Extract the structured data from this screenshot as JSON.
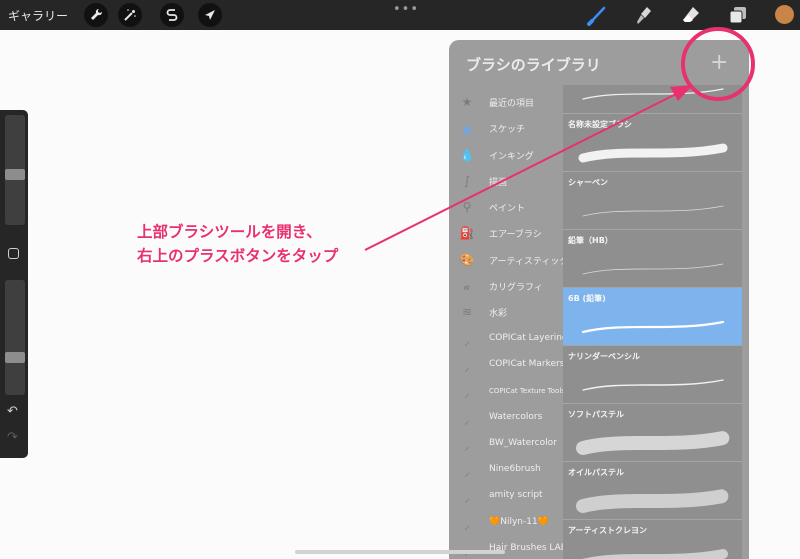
{
  "topbar": {
    "gallery_label": "ギャラリー",
    "actions_icon": "wrench-icon",
    "adjustments_icon": "magic-wand-icon",
    "selection_icon": "selection-s-icon",
    "transform_icon": "arrow-cursor-icon",
    "more_label": "•••",
    "tools": [
      "brush-icon",
      "smudge-icon",
      "eraser-icon",
      "layers-icon"
    ],
    "active_tool": "brush-icon",
    "color_swatch": "#c98448"
  },
  "sidebar": {
    "size_level": 0.55,
    "opacity_level": 0.8,
    "undo_label": "↶",
    "redo_label": "↷"
  },
  "panel": {
    "title": "ブラシのライブラリ",
    "add_label": "+",
    "categories": [
      {
        "label": "最近の項目",
        "icon": "star-icon"
      },
      {
        "label": "スケッチ",
        "icon": "pencil-tip-icon"
      },
      {
        "label": "インキング",
        "icon": "ink-drop-icon"
      },
      {
        "label": "描画",
        "icon": "swirl-icon"
      },
      {
        "label": "ペイント",
        "icon": "paintbrush-icon"
      },
      {
        "label": "エアーブラシ",
        "icon": "airbrush-icon"
      },
      {
        "label": "アーティスティック",
        "icon": "palette-icon"
      },
      {
        "label": "カリグラフィ",
        "icon": "calligraphy-icon"
      },
      {
        "label": "水彩",
        "icon": "waves-icon"
      },
      {
        "label": "COPICat Layering",
        "icon": "feather-icon"
      },
      {
        "label": "COPICat Markers",
        "icon": "feather-icon"
      },
      {
        "label": "COPICat Texture Tools",
        "icon": "feather-icon"
      },
      {
        "label": "Watercolors",
        "icon": "feather-icon"
      },
      {
        "label": "BW_Watercolor",
        "icon": "feather-icon"
      },
      {
        "label": "Nine6brush",
        "icon": "feather-icon"
      },
      {
        "label": "amity script",
        "icon": "feather-icon"
      },
      {
        "label": "🧡Nilyn-11🧡",
        "icon": "feather-icon"
      },
      {
        "label": "Hair Brushes LABS",
        "icon": "feather-icon"
      }
    ],
    "brushes": [
      {
        "name": ""
      },
      {
        "name": "名称未設定ブラシ"
      },
      {
        "name": "シャーペン"
      },
      {
        "name": "鉛筆（HB）"
      },
      {
        "name": "6B (鉛筆)"
      },
      {
        "name": "ナリンダーペンシル"
      },
      {
        "name": "ソフトパステル"
      },
      {
        "name": "オイルパステル"
      },
      {
        "name": "アーティストクレヨン"
      }
    ],
    "selected_brush": "6B (鉛筆)"
  },
  "annotation": {
    "line1": "上部ブラシツールを開き、",
    "line2": "右上のプラスボタンをタップ",
    "color": "#e8316e"
  }
}
